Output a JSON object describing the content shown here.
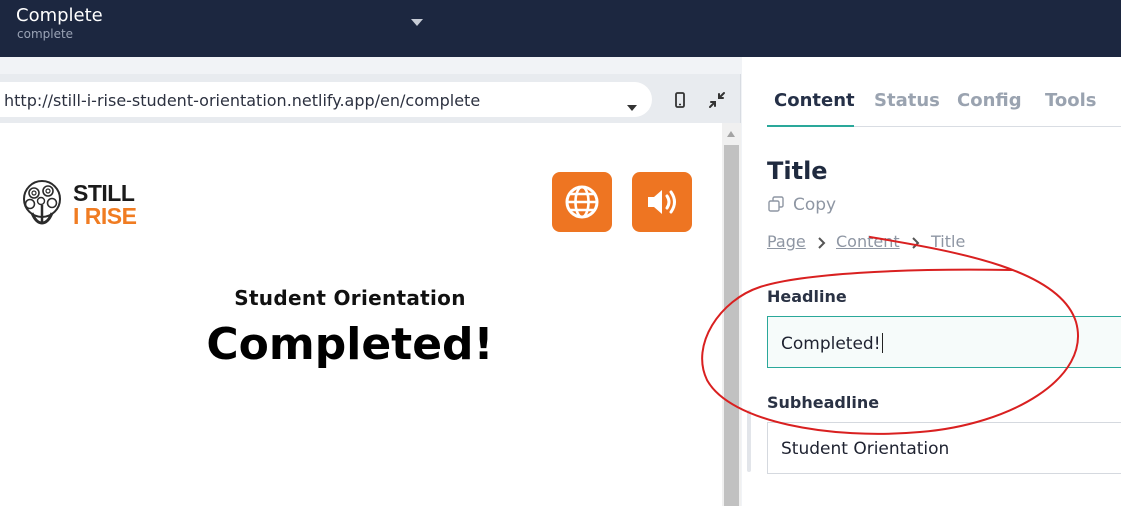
{
  "topbar": {
    "page_title": "Complete",
    "page_slug": "complete"
  },
  "preview": {
    "url": "http://still-i-rise-student-orientation.netlify.app/en/complete",
    "logo_line_1": "STILL",
    "logo_line_2": "I RISE",
    "subheadline": "Student Orientation",
    "headline": "Completed!"
  },
  "editor": {
    "tabs": [
      {
        "label": "Content",
        "active": true
      },
      {
        "label": "Status",
        "active": false
      },
      {
        "label": "Config",
        "active": false
      },
      {
        "label": "Tools",
        "active": false
      }
    ],
    "block_title": "Title",
    "copy_label": "Copy",
    "breadcrumb": [
      "Page",
      "Content",
      "Title"
    ],
    "fields": {
      "headline_label": "Headline",
      "headline_value": "Completed!",
      "subheadline_label": "Subheadline",
      "subheadline_value": "Student Orientation"
    }
  },
  "colors": {
    "topbar_bg": "#1c2740",
    "brand_orange": "#ee7522",
    "accent_teal": "#2aa89a",
    "annotation_red": "#d92020"
  }
}
